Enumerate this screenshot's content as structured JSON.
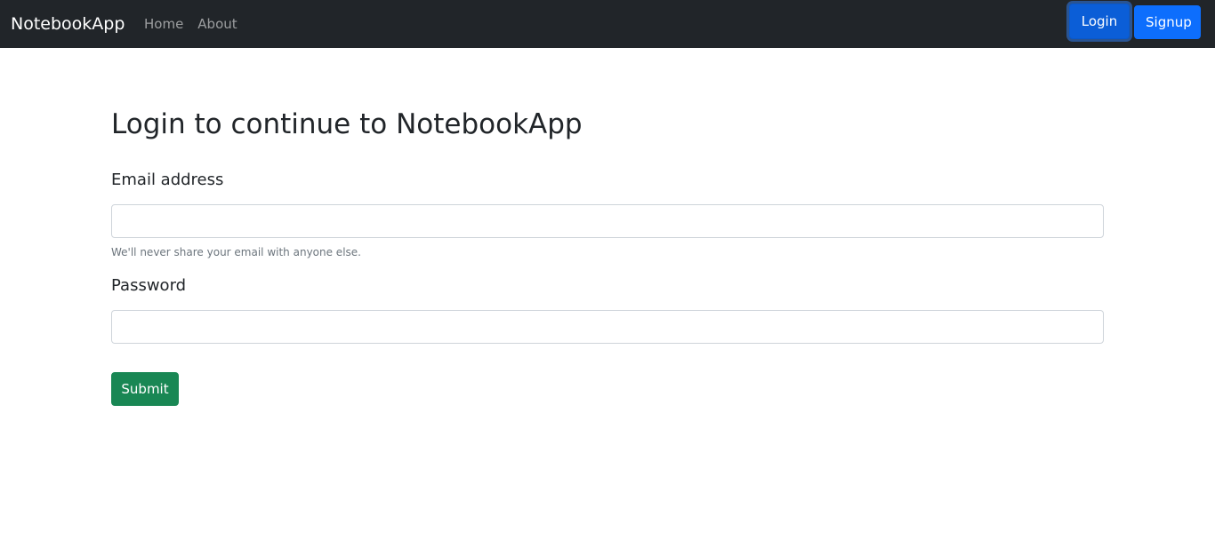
{
  "navbar": {
    "brand": "NotebookApp",
    "links": [
      {
        "label": "Home"
      },
      {
        "label": "About"
      }
    ],
    "login_label": "Login",
    "signup_label": "Signup"
  },
  "form": {
    "title": "Login to continue to NotebookApp",
    "email_label": "Email address",
    "email_value": "",
    "email_help": "We'll never share your email with anyone else.",
    "password_label": "Password",
    "password_value": "",
    "submit_label": "Submit"
  },
  "colors": {
    "navbar_bg": "#212529",
    "primary": "#0d6efd",
    "success": "#198754",
    "muted_text": "#6c757d"
  }
}
